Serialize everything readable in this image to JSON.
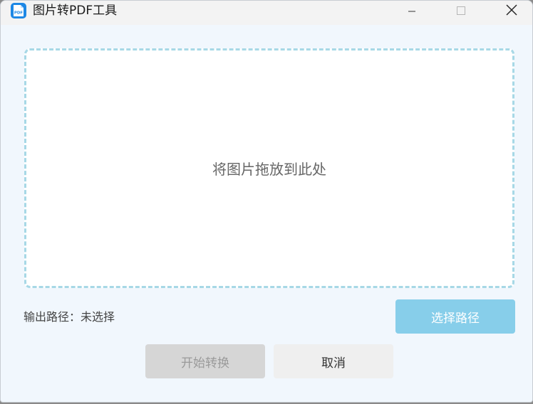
{
  "window": {
    "title": "图片转PDF工具",
    "app_icon": {
      "name": "pdf-app-icon",
      "label": "PDF",
      "color": "#1e88e5"
    },
    "controls": {
      "minimize": "minimize-icon",
      "maximize": "maximize-icon",
      "close": "close-icon"
    }
  },
  "drop_zone": {
    "text": "将图片拖放到此处",
    "border_color": "#a7d8e6"
  },
  "output": {
    "label": "输出路径：未选择"
  },
  "buttons": {
    "choose_path": "选择路径",
    "start": "开始转换",
    "cancel": "取消"
  },
  "colors": {
    "accent": "#87ceea",
    "disabled": "#d6d6d6",
    "background": "#f1f7fd"
  }
}
